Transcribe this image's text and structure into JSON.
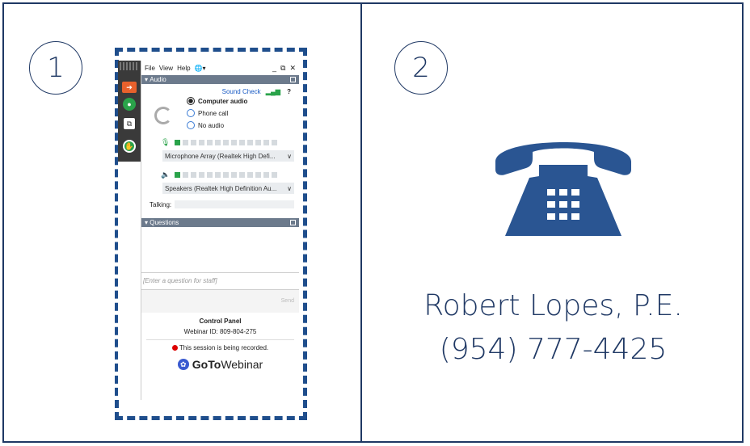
{
  "steps": [
    "1",
    "2"
  ],
  "goto_panel": {
    "menu": [
      "File",
      "View",
      "Help"
    ],
    "window_controls": [
      "_",
      "⧉",
      "✕"
    ],
    "audio_section": {
      "title": "Audio",
      "sound_check": "Sound Check",
      "help": "?",
      "options": [
        {
          "label": "Computer audio",
          "selected": true
        },
        {
          "label": "Phone call",
          "selected": false
        },
        {
          "label": "No audio",
          "selected": false
        }
      ],
      "mic_level": 1,
      "speaker_level": 1,
      "mic_device": "Microphone Array (Realtek High Defi...",
      "speaker_device": "Speakers (Realtek High Definition Au...",
      "talking_label": "Talking:"
    },
    "questions_section": {
      "title": "Questions",
      "input_placeholder": "[Enter a question for staff]",
      "send_label": "Send"
    },
    "footer": {
      "title": "Control Panel",
      "webinar_id": "Webinar ID: 809-804-275",
      "recording_notice": "This session is being recorded.",
      "logo_bold": "GoTo",
      "logo_rest": "Webinar"
    }
  },
  "contact": {
    "name": "Robert Lopes, P.E.",
    "phone": "(954) 777-4425"
  },
  "colors": {
    "navy": "#1f3864",
    "phone_icon": "#2a5592",
    "dash": "#1f4e8c"
  }
}
